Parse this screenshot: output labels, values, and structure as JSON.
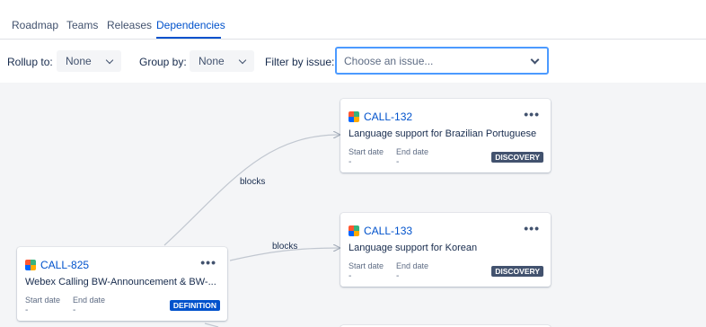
{
  "tabs": [
    {
      "label": "Roadmap"
    },
    {
      "label": "Teams"
    },
    {
      "label": "Releases"
    },
    {
      "label": "Dependencies"
    }
  ],
  "toolbar": {
    "rollup_label": "Rollup to:",
    "rollup_value": "None",
    "groupby_label": "Group by:",
    "groupby_value": "None",
    "filter_label": "Filter by issue:",
    "filter_placeholder": "Choose an issue..."
  },
  "edges": [
    {
      "label": "blocks"
    },
    {
      "label": "blocks"
    }
  ],
  "cards": [
    {
      "key": "CALL-132",
      "summary": "Language support for Brazilian Portuguese",
      "start_label": "Start date",
      "start_value": "-",
      "end_label": "End date",
      "end_value": "-",
      "status": "DISCOVERY",
      "status_color": "#42526e"
    },
    {
      "key": "CALL-133",
      "summary": "Language support for Korean",
      "start_label": "Start date",
      "start_value": "-",
      "end_label": "End date",
      "end_value": "-",
      "status": "DISCOVERY",
      "status_color": "#42526e"
    },
    {
      "key": "CALL-825",
      "summary": "Webex Calling BW-Announcement & BW-...",
      "start_label": "Start date",
      "start_value": "-",
      "end_label": "End date",
      "end_value": "-",
      "status": "DEFINITION",
      "status_color": "#0052cc"
    }
  ],
  "icons": {
    "issue_type": "multicolor-issue-icon",
    "more": "more-horizontal-icon",
    "dropdown": "chevron-down-icon"
  },
  "colors": {
    "accent": "#0052cc",
    "focus": "#4c9aff",
    "canvas": "#f4f5f7"
  }
}
